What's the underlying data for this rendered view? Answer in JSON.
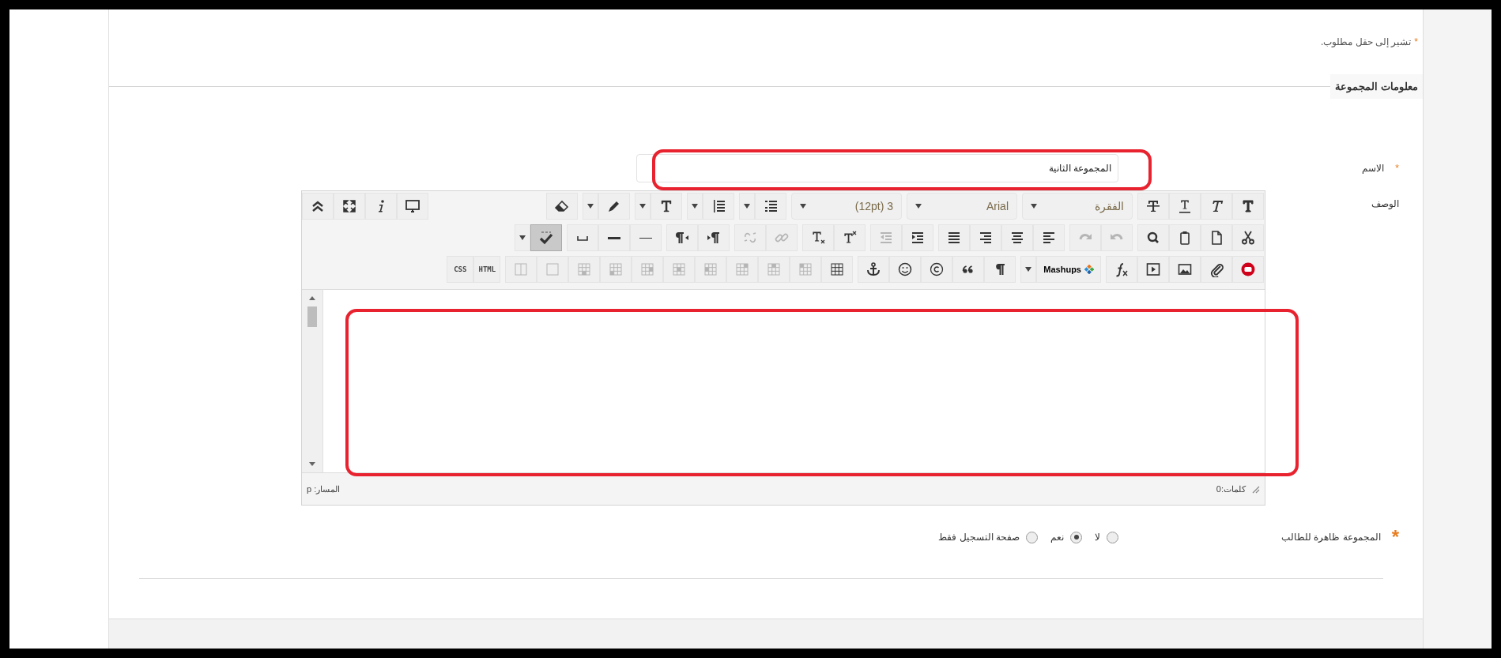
{
  "required_note": {
    "mark": "*",
    "text": "تشير إلى حقل مطلوب."
  },
  "section_title": "معلومات المجموعة",
  "name_field": {
    "mark": "*",
    "label": "الاسم",
    "value": "المجموعة الثانية",
    "outlined": true
  },
  "description": {
    "label": "الوصف"
  },
  "editor": {
    "outlined": true,
    "toolbar": [
      {
        "groups": [
          {
            "items": [
              {
                "kind": "icon",
                "disabled": false,
                "pressed": false
              },
              {
                "kind": "icon",
                "disabled": false,
                "pressed": false
              },
              {
                "kind": "icon",
                "disabled": false,
                "pressed": false
              },
              {
                "kind": "icon",
                "disabled": false,
                "pressed": false
              }
            ]
          },
          {
            "items": [
              {
                "kind": "select",
                "label": "الفقرة",
                "disabled": false,
                "pressed": false
              }
            ]
          },
          {
            "items": [
              {
                "kind": "select",
                "label": "Arial",
                "disabled": false,
                "pressed": false
              }
            ]
          },
          {
            "items": [
              {
                "kind": "select",
                "label": "(12pt) 3",
                "disabled": false,
                "pressed": false
              }
            ]
          },
          {
            "items": [
              {
                "kind": "icon",
                "disabled": false,
                "pressed": false
              },
              {
                "kind": "caret",
                "disabled": false,
                "pressed": false
              }
            ]
          },
          {
            "items": [
              {
                "kind": "icon",
                "disabled": false,
                "pressed": false
              },
              {
                "kind": "caret",
                "disabled": false,
                "pressed": false
              }
            ]
          },
          {
            "items": [
              {
                "kind": "icon",
                "disabled": false,
                "pressed": false
              },
              {
                "kind": "caret",
                "disabled": false,
                "pressed": false
              }
            ]
          },
          {
            "items": [
              {
                "kind": "icon",
                "disabled": false,
                "pressed": false
              },
              {
                "kind": "caret",
                "disabled": false,
                "pressed": false
              }
            ]
          },
          {
            "items": [
              {
                "kind": "icon",
                "disabled": false,
                "pressed": false
              }
            ]
          },
          {
            "items": [
              {
                "kind": "icon",
                "disabled": false,
                "pressed": false
              },
              {
                "kind": "icon",
                "disabled": false,
                "pressed": false
              },
              {
                "kind": "icon",
                "disabled": false,
                "pressed": false
              },
              {
                "kind": "icon",
                "disabled": false,
                "pressed": false
              }
            ]
          }
        ]
      },
      {
        "groups": [
          {
            "items": [
              {
                "kind": "icon",
                "disabled": false,
                "pressed": false
              },
              {
                "kind": "icon",
                "disabled": false,
                "pressed": false
              },
              {
                "kind": "icon",
                "disabled": false,
                "pressed": false
              },
              {
                "kind": "icon",
                "disabled": false,
                "pressed": false
              }
            ]
          },
          {
            "items": [
              {
                "kind": "icon",
                "disabled": true,
                "pressed": false
              },
              {
                "kind": "icon",
                "disabled": true,
                "pressed": false
              }
            ]
          },
          {
            "items": [
              {
                "kind": "icon",
                "disabled": false,
                "pressed": false
              },
              {
                "kind": "icon",
                "disabled": false,
                "pressed": false
              },
              {
                "kind": "icon",
                "disabled": false,
                "pressed": false
              },
              {
                "kind": "icon",
                "disabled": false,
                "pressed": false
              }
            ]
          },
          {
            "items": [
              {
                "kind": "icon",
                "disabled": false,
                "pressed": false
              },
              {
                "kind": "icon",
                "disabled": true,
                "pressed": false
              }
            ]
          },
          {
            "items": [
              {
                "kind": "icon",
                "disabled": false,
                "pressed": false
              },
              {
                "kind": "icon",
                "disabled": false,
                "pressed": false
              }
            ]
          },
          {
            "items": [
              {
                "kind": "icon",
                "disabled": true,
                "pressed": false
              },
              {
                "kind": "icon",
                "disabled": true,
                "pressed": false
              }
            ]
          },
          {
            "items": [
              {
                "kind": "icon",
                "disabled": false,
                "pressed": false
              },
              {
                "kind": "icon",
                "disabled": false,
                "pressed": false
              }
            ]
          },
          {
            "items": [
              {
                "kind": "icon",
                "disabled": false,
                "pressed": false
              },
              {
                "kind": "icon",
                "disabled": false,
                "pressed": false
              },
              {
                "kind": "icon",
                "disabled": false,
                "pressed": false
              }
            ]
          },
          {
            "items": [
              {
                "kind": "icon",
                "disabled": false,
                "pressed": true
              },
              {
                "kind": "caret",
                "disabled": false,
                "pressed": false
              }
            ]
          }
        ]
      },
      {
        "groups": [
          {
            "items": [
              {
                "kind": "icon",
                "disabled": false,
                "pressed": false
              },
              {
                "kind": "icon",
                "disabled": false,
                "pressed": false
              },
              {
                "kind": "icon",
                "disabled": false,
                "pressed": false
              },
              {
                "kind": "icon",
                "disabled": false,
                "pressed": false
              },
              {
                "kind": "icon",
                "disabled": false,
                "pressed": false
              }
            ]
          },
          {
            "items": [
              {
                "kind": "menu",
                "label": "Mashups",
                "disabled": false,
                "pressed": false
              },
              {
                "kind": "caret",
                "disabled": false,
                "pressed": false
              }
            ]
          },
          {
            "items": [
              {
                "kind": "icon",
                "disabled": false,
                "pressed": false
              },
              {
                "kind": "icon",
                "disabled": false,
                "pressed": false
              },
              {
                "kind": "icon",
                "disabled": false,
                "pressed": false
              },
              {
                "kind": "icon",
                "disabled": false,
                "pressed": false
              },
              {
                "kind": "icon",
                "disabled": false,
                "pressed": false
              }
            ]
          },
          {
            "items": [
              {
                "kind": "icon",
                "disabled": false,
                "pressed": false
              },
              {
                "kind": "icon",
                "disabled": true,
                "pressed": false
              },
              {
                "kind": "icon",
                "disabled": true,
                "pressed": false
              },
              {
                "kind": "icon",
                "disabled": true,
                "pressed": false
              },
              {
                "kind": "icon",
                "disabled": true,
                "pressed": false
              },
              {
                "kind": "icon",
                "disabled": true,
                "pressed": false
              },
              {
                "kind": "icon",
                "disabled": true,
                "pressed": false
              },
              {
                "kind": "icon",
                "disabled": true,
                "pressed": false
              },
              {
                "kind": "icon",
                "disabled": true,
                "pressed": false
              },
              {
                "kind": "icon",
                "disabled": true,
                "pressed": false
              },
              {
                "kind": "icon",
                "disabled": true,
                "pressed": false
              }
            ]
          },
          {
            "items": [
              {
                "kind": "text",
                "label": "HTML",
                "disabled": false,
                "pressed": false
              },
              {
                "kind": "text",
                "label": "CSS",
                "disabled": false,
                "pressed": false
              }
            ]
          }
        ]
      }
    ],
    "word_count": "كلمات:0",
    "path": "المسار: p"
  },
  "visibility": {
    "mark": "*",
    "label": "المجموعة ظاهرة للطالب",
    "options": [
      {
        "label": "لا",
        "selected": false
      },
      {
        "label": "نعم",
        "selected": true
      },
      {
        "label": "صفحة التسجيل فقط",
        "selected": false
      }
    ]
  }
}
